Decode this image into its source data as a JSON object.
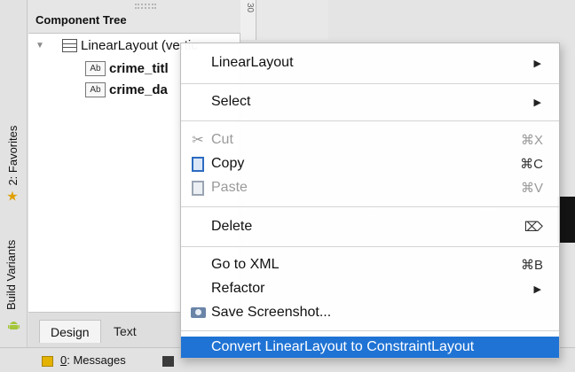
{
  "side_tabs": {
    "favorites": "2: Favorites",
    "build_variants": "Build Variants"
  },
  "component_tree": {
    "title": "Component Tree",
    "root": "LinearLayout (vertic",
    "children": [
      "crime_titl",
      "crime_da"
    ],
    "widget_icon": "Ab"
  },
  "ruler": {
    "label": "30"
  },
  "editor_tabs": {
    "design": "Design",
    "text": "Text"
  },
  "status_bar": {
    "messages_hotkey": "0",
    "messages_label": ": Messages"
  },
  "context_menu": {
    "linear_layout": "LinearLayout",
    "select": "Select",
    "cut": "Cut",
    "cut_shortcut": "⌘X",
    "copy": "Copy",
    "copy_shortcut": "⌘C",
    "paste": "Paste",
    "paste_shortcut": "⌘V",
    "delete": "Delete",
    "delete_shortcut": "⌦",
    "go_to_xml": "Go to XML",
    "go_to_xml_shortcut": "⌘B",
    "refactor": "Refactor",
    "save_screenshot": "Save Screenshot...",
    "convert": "Convert LinearLayout to ConstraintLayout",
    "submenu_arrow": "▶"
  },
  "colors": {
    "selection": "#1f73d4",
    "favorites_star": "#e0a000",
    "android_green": "#a4c639"
  },
  "icons": [
    "star-icon",
    "android-icon",
    "scissors-icon",
    "copy-icon",
    "paste-icon",
    "camera-icon",
    "layout-icon",
    "textview-icon",
    "messages-icon",
    "terminal-icon"
  ]
}
